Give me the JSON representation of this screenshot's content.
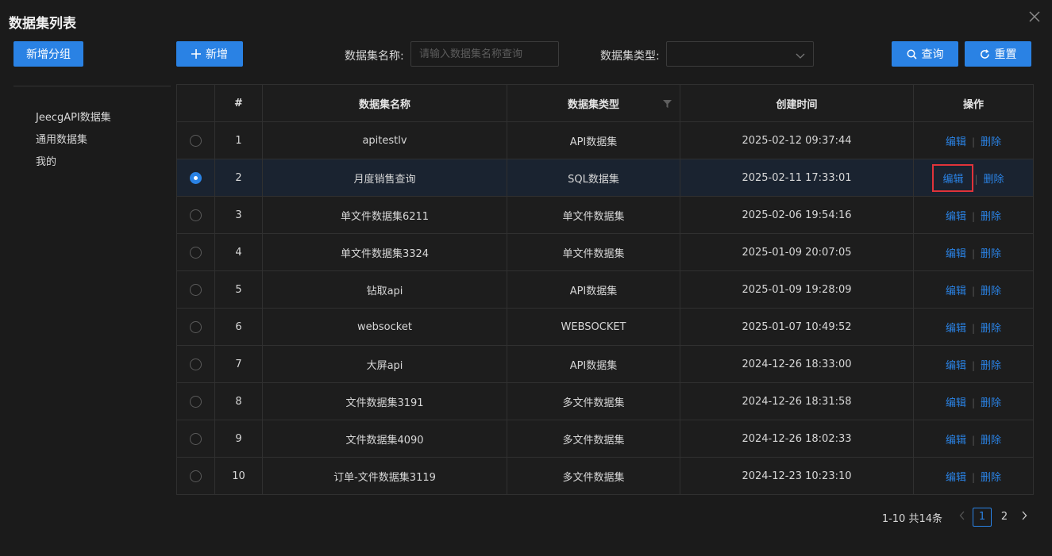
{
  "dialog": {
    "title": "数据集列表"
  },
  "sidebar": {
    "add_group_label": "新增分组",
    "groups": [
      "JeecgAPI数据集",
      "通用数据集",
      "我的"
    ]
  },
  "toolbar": {
    "add_label": "新增",
    "name_filter_label": "数据集名称:",
    "name_filter_placeholder": "请输入数据集名称查询",
    "name_filter_value": "",
    "type_filter_label": "数据集类型:",
    "type_filter_value": "",
    "query_label": "查询",
    "reset_label": "重置"
  },
  "table": {
    "columns": [
      "#",
      "数据集名称",
      "数据集类型",
      "创建时间",
      "操作"
    ],
    "edit_label": "编辑",
    "delete_label": "删除",
    "rows": [
      {
        "num": "1",
        "name": "apitestlv",
        "type": "API数据集",
        "created": "2025-02-12 09:37:44",
        "selected": false
      },
      {
        "num": "2",
        "name": "月度销售查询",
        "type": "SQL数据集",
        "created": "2025-02-11 17:33:01",
        "selected": true
      },
      {
        "num": "3",
        "name": "单文件数据集6211",
        "type": "单文件数据集",
        "created": "2025-02-06 19:54:16",
        "selected": false
      },
      {
        "num": "4",
        "name": "单文件数据集3324",
        "type": "单文件数据集",
        "created": "2025-01-09 20:07:05",
        "selected": false
      },
      {
        "num": "5",
        "name": "钻取api",
        "type": "API数据集",
        "created": "2025-01-09 19:28:09",
        "selected": false
      },
      {
        "num": "6",
        "name": "websocket",
        "type": "WEBSOCKET",
        "created": "2025-01-07 10:49:52",
        "selected": false
      },
      {
        "num": "7",
        "name": "大屏api",
        "type": "API数据集",
        "created": "2024-12-26 18:33:00",
        "selected": false
      },
      {
        "num": "8",
        "name": "文件数据集3191",
        "type": "多文件数据集",
        "created": "2024-12-26 18:31:58",
        "selected": false
      },
      {
        "num": "9",
        "name": "文件数据集4090",
        "type": "多文件数据集",
        "created": "2024-12-26 18:02:33",
        "selected": false
      },
      {
        "num": "10",
        "name": "订单-文件数据集3119",
        "type": "多文件数据集",
        "created": "2024-12-23 10:23:10",
        "selected": false
      }
    ]
  },
  "pagination": {
    "total_text": "1-10 共14条",
    "pages": [
      "1",
      "2"
    ],
    "current": "1"
  },
  "colors": {
    "accent": "#2a82e4",
    "highlight_border": "#e0333a",
    "background": "#1b1b1b"
  }
}
